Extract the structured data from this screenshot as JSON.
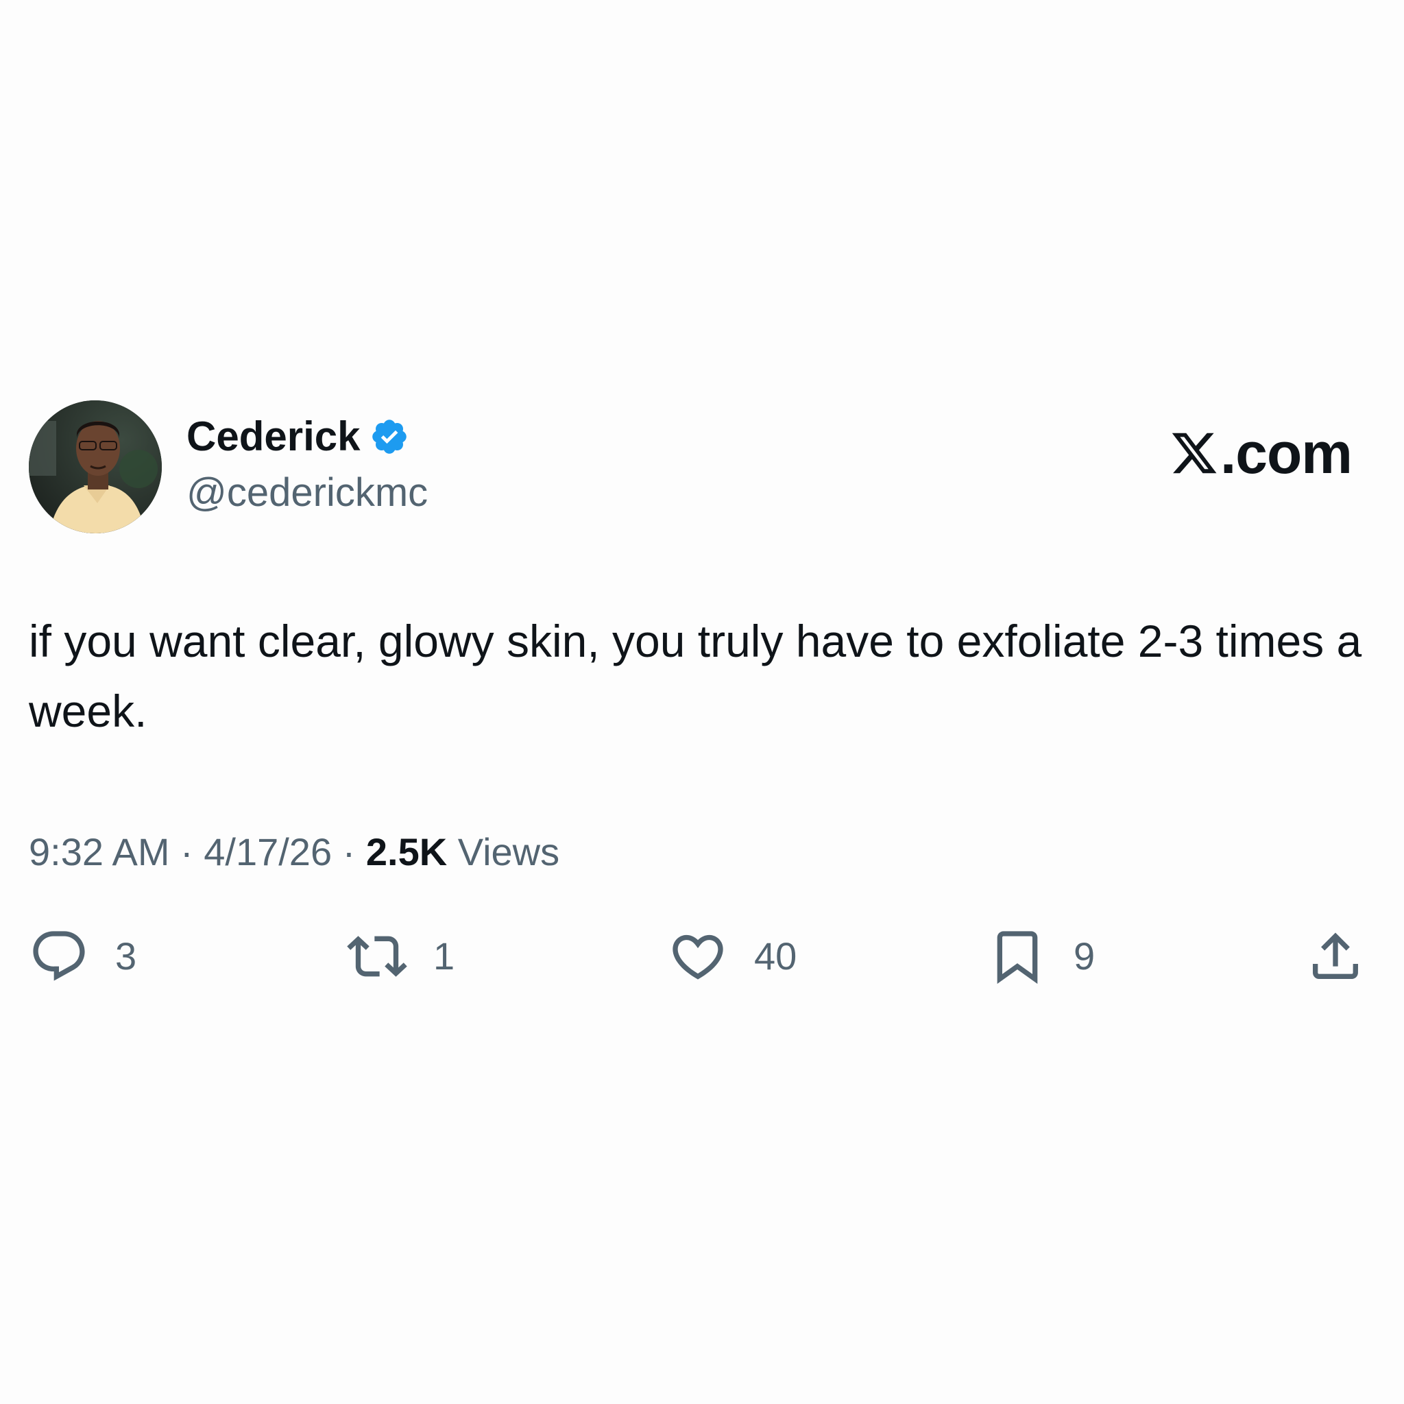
{
  "author": {
    "display_name": "Cederick",
    "handle": "@cederickmc",
    "verified": true
  },
  "site": {
    "label": ".com",
    "logo_icon": "x-logo-icon"
  },
  "tweet": {
    "text": "if you want clear, glowy skin, you truly have to exfoliate 2-3 times a week.",
    "time": "9:32 AM",
    "date": "4/17/26",
    "views_count": "2.5K",
    "views_label": "Views",
    "separator": "·"
  },
  "actions": {
    "reply": {
      "icon": "reply-icon",
      "count": "3"
    },
    "retweet": {
      "icon": "retweet-icon",
      "count": "1"
    },
    "like": {
      "icon": "heart-icon",
      "count": "40"
    },
    "bookmark": {
      "icon": "bookmark-icon",
      "count": "9"
    },
    "share": {
      "icon": "share-icon"
    }
  },
  "colors": {
    "background": "#fdfdfd",
    "text": "#0f1419",
    "secondary": "#536471",
    "verified": "#1d9bf0"
  }
}
